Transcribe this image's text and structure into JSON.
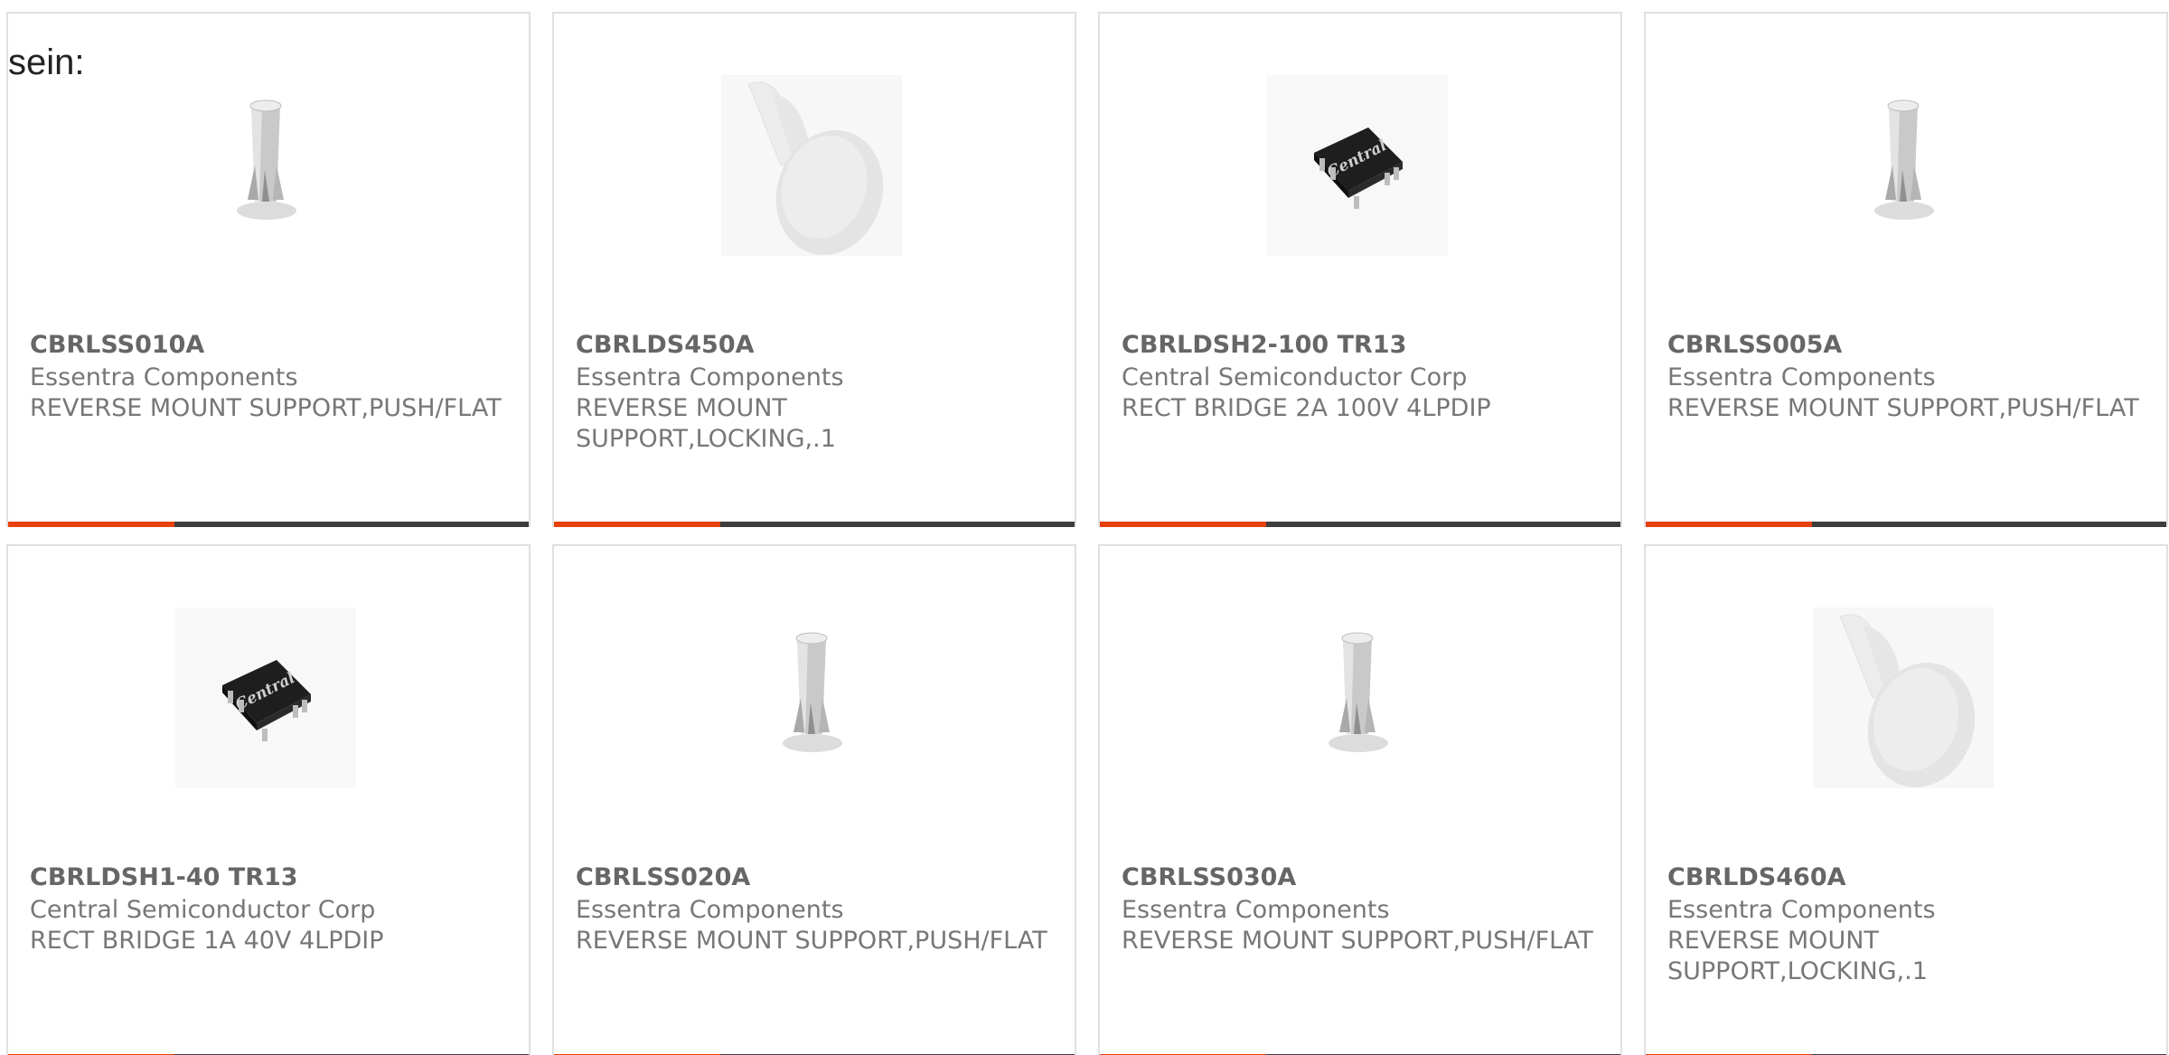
{
  "intro_text": "sein:",
  "colors": {
    "accent": "#e8400c",
    "bar": "#3d3d3d",
    "border": "#e0e0e0"
  },
  "products": [
    {
      "part_number": "CBRLSS010A",
      "manufacturer": "Essentra Components",
      "description": "REVERSE MOUNT SUPPORT,PUSH/FLAT",
      "image": "post-icon"
    },
    {
      "part_number": "CBRLDS450A",
      "manufacturer": "Essentra Components",
      "description": "REVERSE MOUNT SUPPORT,LOCKING,.1",
      "image": "locking-support-icon"
    },
    {
      "part_number": "CBRLDSH2-100 TR13",
      "manufacturer": "Central Semiconductor Corp",
      "description": "RECT BRIDGE 2A 100V 4LPDIP",
      "image": "chip-icon"
    },
    {
      "part_number": "CBRLSS005A",
      "manufacturer": "Essentra Components",
      "description": "REVERSE MOUNT SUPPORT,PUSH/FLAT",
      "image": "post-icon"
    },
    {
      "part_number": "CBRLDSH1-40 TR13",
      "manufacturer": "Central Semiconductor Corp",
      "description": "RECT BRIDGE 1A 40V 4LPDIP",
      "image": "chip-icon"
    },
    {
      "part_number": "CBRLSS020A",
      "manufacturer": "Essentra Components",
      "description": "REVERSE MOUNT SUPPORT,PUSH/FLAT",
      "image": "post-icon"
    },
    {
      "part_number": "CBRLSS030A",
      "manufacturer": "Essentra Components",
      "description": "REVERSE MOUNT SUPPORT,PUSH/FLAT",
      "image": "post-icon"
    },
    {
      "part_number": "CBRLDS460A",
      "manufacturer": "Essentra Components",
      "description": "REVERSE MOUNT SUPPORT,LOCKING,.1",
      "image": "locking-support-icon"
    }
  ],
  "chip_label": "Central"
}
